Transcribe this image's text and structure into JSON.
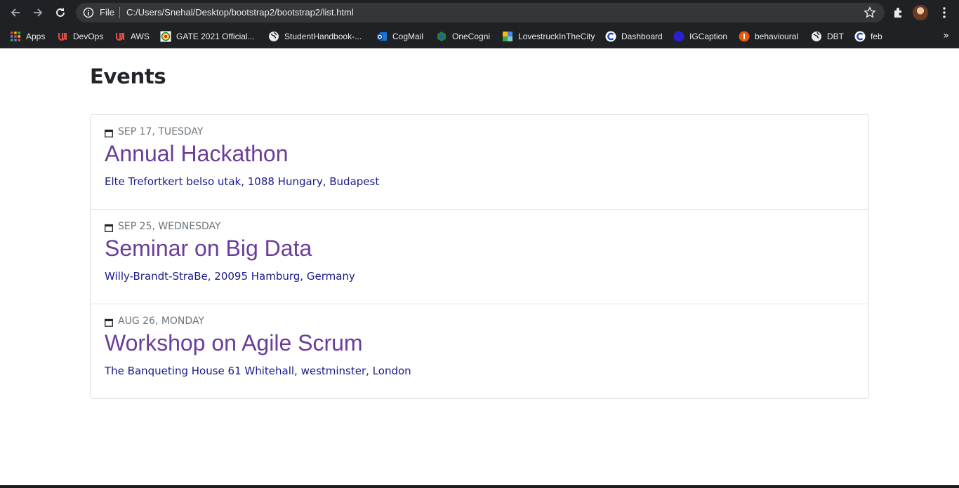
{
  "browser": {
    "protocol_label": "File",
    "url": "C:/Users/Snehal/Desktop/bootstrap2/bootstrap2/list.html",
    "icons": [
      "back-icon",
      "forward-icon",
      "reload-icon",
      "info-icon",
      "star-icon",
      "extensions-icon",
      "menu-icon"
    ]
  },
  "bookmarks": [
    {
      "label": "Apps",
      "icon": "apps-grid-icon"
    },
    {
      "label": "DevOps",
      "icon": "u-logo-icon"
    },
    {
      "label": "AWS",
      "icon": "u-logo-icon"
    },
    {
      "label": "GATE 2021 Official...",
      "icon": "gate-icon"
    },
    {
      "label": "StudentHandbook-...",
      "icon": "globe-icon"
    },
    {
      "label": "CogMail",
      "icon": "outlook-icon"
    },
    {
      "label": "OneCogni",
      "icon": "onecogni-icon"
    },
    {
      "label": "LovestruckInTheCity",
      "icon": "drive-icon"
    },
    {
      "label": "Dashboard",
      "icon": "c-logo-icon"
    },
    {
      "label": "IGCaption",
      "icon": "circle-icon"
    },
    {
      "label": "behavioural",
      "icon": "orange-circle-icon"
    },
    {
      "label": "DBT",
      "icon": "globe-icon"
    },
    {
      "label": "feb",
      "icon": "c-logo-icon"
    }
  ],
  "bookmarks_more": "»",
  "page": {
    "title": "Events",
    "events": [
      {
        "date": "SEP 17, TUESDAY",
        "title": "Annual Hackathon",
        "address": "Elte Trefortkert belso utak, 1088 Hungary, Budapest"
      },
      {
        "date": "SEP 25, WEDNESDAY",
        "title": "Seminar on Big Data",
        "address": "Willy-Brandt-StraBe, 20095 Hamburg, Germany"
      },
      {
        "date": "AUG 26, MONDAY",
        "title": "Workshop on Agile Scrum",
        "address": "The Banqueting House 61 Whitehall, westminster, London"
      }
    ]
  },
  "colors": {
    "chrome_bg": "#202124",
    "omnibox_bg": "#35363a",
    "event_title": "#6a3d9a",
    "event_address": "#1a1a8c",
    "date_text": "#6c757d",
    "border": "#dee2e6"
  }
}
